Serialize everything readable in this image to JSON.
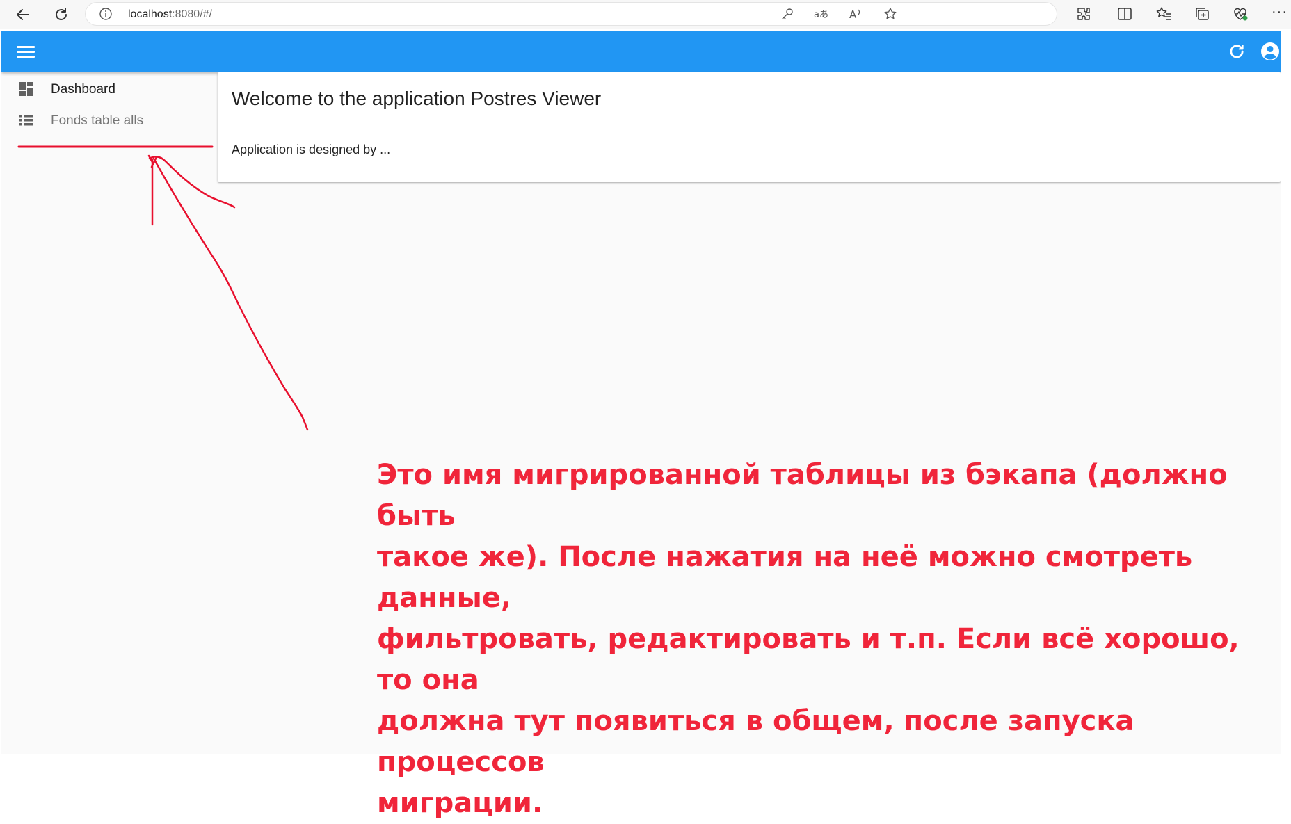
{
  "browser": {
    "url_host": "localhost",
    "url_path": ":8080/#/",
    "icons": [
      "back-icon",
      "reload-icon",
      "info-icon",
      "key-icon",
      "translate-icon",
      "read-aloud-icon",
      "favorite-star-icon",
      "extensions-icon",
      "split-screen-icon",
      "favorites-icon",
      "collections-icon",
      "performance-icon",
      "more-icon"
    ],
    "more_label": "···"
  },
  "app_bar": {
    "color": "#2196f3",
    "icons": [
      "menu-icon",
      "refresh-icon",
      "account-icon"
    ]
  },
  "sidebar": {
    "items": [
      {
        "label": "Dashboard",
        "icon": "dashboard-icon"
      },
      {
        "label": "Fonds table alls",
        "icon": "list-icon"
      }
    ]
  },
  "main": {
    "title": "Welcome to the application Postres Viewer",
    "body": "Application is designed by ..."
  },
  "annotation": {
    "color": "#f0253a",
    "lines": [
      "Это имя мигрированной таблицы из бэкапа (должно быть",
      "такое же). После нажатия на неё можно смотреть данные,",
      "фильтровать, редактировать и т.п. Если всё хорошо, то она",
      "должна тут появиться в общем, после запуска процессов",
      "миграции."
    ]
  }
}
